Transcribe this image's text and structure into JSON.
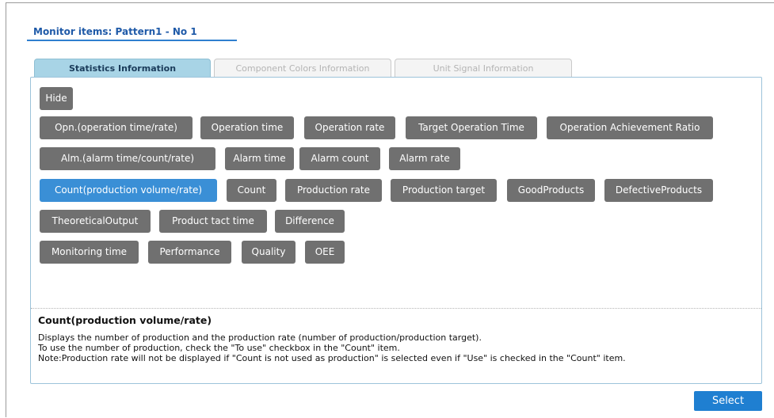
{
  "header": {
    "title": "Monitor items: Pattern1 - No 1"
  },
  "tabs": [
    {
      "label": "Statistics Information",
      "active": true
    },
    {
      "label": "Component Colors Information",
      "active": false
    },
    {
      "label": "Unit Signal Information",
      "active": false
    }
  ],
  "items": {
    "hide": "Hide",
    "opn": "Opn.(operation time/rate)",
    "operation_time": "Operation time",
    "operation_rate": "Operation rate",
    "target_operation_time": "Target Operation Time",
    "operation_achievement_ratio": "Operation Achievement Ratio",
    "alm": "Alm.(alarm time/count/rate)",
    "alarm_time": "Alarm time",
    "alarm_count": "Alarm count",
    "alarm_rate": "Alarm rate",
    "count_group": "Count(production volume/rate)",
    "count": "Count",
    "production_rate": "Production rate",
    "production_target": "Production target",
    "good_products": "GoodProducts",
    "defective_products": "DefectiveProducts",
    "theoretical_output": "TheoreticalOutput",
    "product_tact_time": "Product tact time",
    "difference": "Difference",
    "monitoring_time": "Monitoring time",
    "performance": "Performance",
    "quality": "Quality",
    "oee": "OEE"
  },
  "description": {
    "title": "Count(production volume/rate)",
    "line1": "Displays the number of production and the production rate (number of production/production target).",
    "line2": "To use the number of production, check the \"To use\" checkbox in the \"Count\" item.",
    "line3": "Note:Production rate will not be displayed if \"Count is not used as production\" is selected even if \"Use\" is checked in the \"Count\" item."
  },
  "footer": {
    "select_label": "Select"
  },
  "colors": {
    "accent": "#3a8fd6",
    "button": "#707070",
    "select": "#1f7fd1",
    "active_tab": "#a8d4e6"
  }
}
